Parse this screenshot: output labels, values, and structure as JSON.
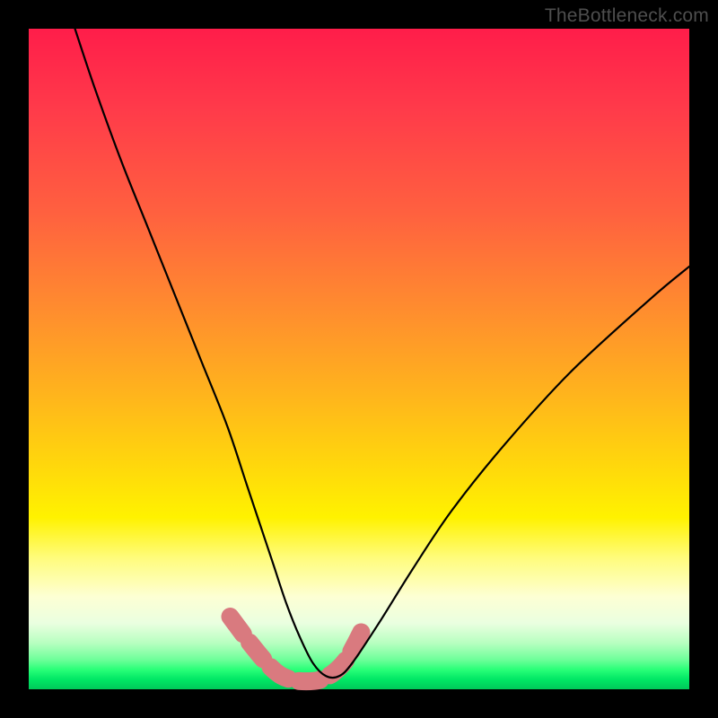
{
  "watermark": "TheBottleneck.com",
  "chart_data": {
    "type": "line",
    "title": "",
    "xlabel": "",
    "ylabel": "",
    "xlim": [
      0,
      100
    ],
    "ylim": [
      0,
      100
    ],
    "grid": false,
    "legend": false,
    "series": [
      {
        "name": "bottleneck-curve",
        "x": [
          7,
          10,
          14,
          18,
          22,
          26,
          30,
          33,
          35,
          37,
          39,
          41,
          43,
          45,
          47,
          49,
          53,
          58,
          64,
          72,
          82,
          94,
          100
        ],
        "y": [
          100,
          91,
          80,
          70,
          60,
          50,
          40,
          31,
          25,
          19,
          13,
          8,
          4,
          2,
          2,
          4,
          10,
          18,
          27,
          37,
          48,
          59,
          64
        ]
      }
    ],
    "highlight_band": {
      "name": "optimal-range",
      "color": "#d97a7f",
      "x": [
        30.5,
        33.5,
        36,
        38,
        40,
        42,
        44,
        46,
        48,
        49.5,
        51
      ],
      "y": [
        11,
        7,
        4,
        2.2,
        1.4,
        1.2,
        1.4,
        2.4,
        4.4,
        7,
        10
      ]
    },
    "background_gradient_stops": [
      {
        "pos": 0.0,
        "color": "#ff1d4a"
      },
      {
        "pos": 0.28,
        "color": "#ff613f"
      },
      {
        "pos": 0.55,
        "color": "#ffb31d"
      },
      {
        "pos": 0.74,
        "color": "#fff200"
      },
      {
        "pos": 0.9,
        "color": "#eaffe0"
      },
      {
        "pos": 1.0,
        "color": "#00c95a"
      }
    ]
  }
}
